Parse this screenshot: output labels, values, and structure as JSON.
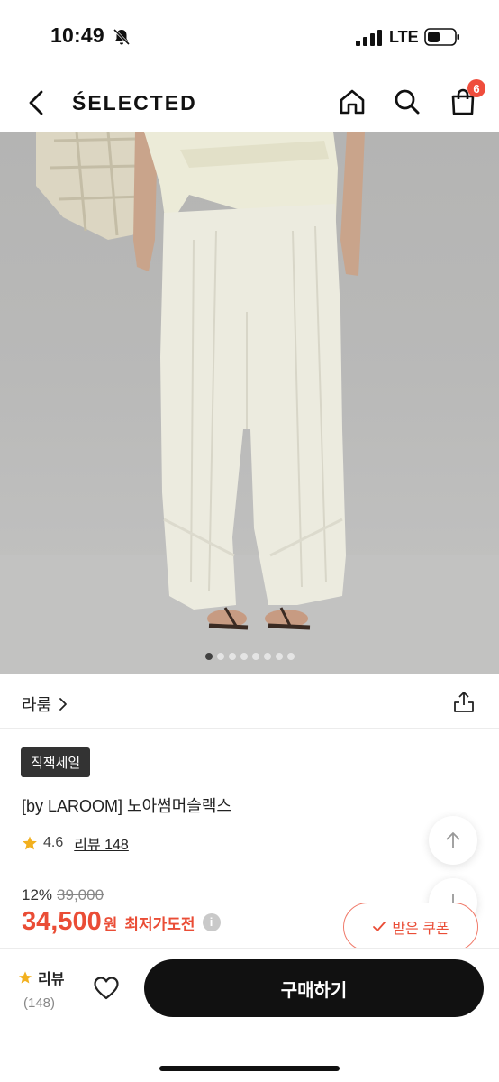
{
  "status_bar": {
    "time": "10:49",
    "network": "LTE"
  },
  "header": {
    "brand": "ŚELECTED",
    "cart_count": "6"
  },
  "gallery": {
    "total_images": 8,
    "active_index": 0
  },
  "product": {
    "brand_name": "라룸",
    "sale_tag": "직잭세일",
    "title": "[by LAROOM] 노아썸머슬랙스",
    "rating": "4.6",
    "review_label": "리뷰 148",
    "discount": "12%",
    "original_price": "39,000",
    "price": "34,500",
    "currency": "원",
    "lowest_label": "최저가도전",
    "info_symbol": "i",
    "coupon_label": "받은 쿠폰"
  },
  "bottom": {
    "review_label": "리뷰",
    "review_count": "(148)",
    "buy_label": "구매하기"
  },
  "colors": {
    "accent": "#ea4d36",
    "badge": "#ef4d3c",
    "dark": "#111111"
  }
}
